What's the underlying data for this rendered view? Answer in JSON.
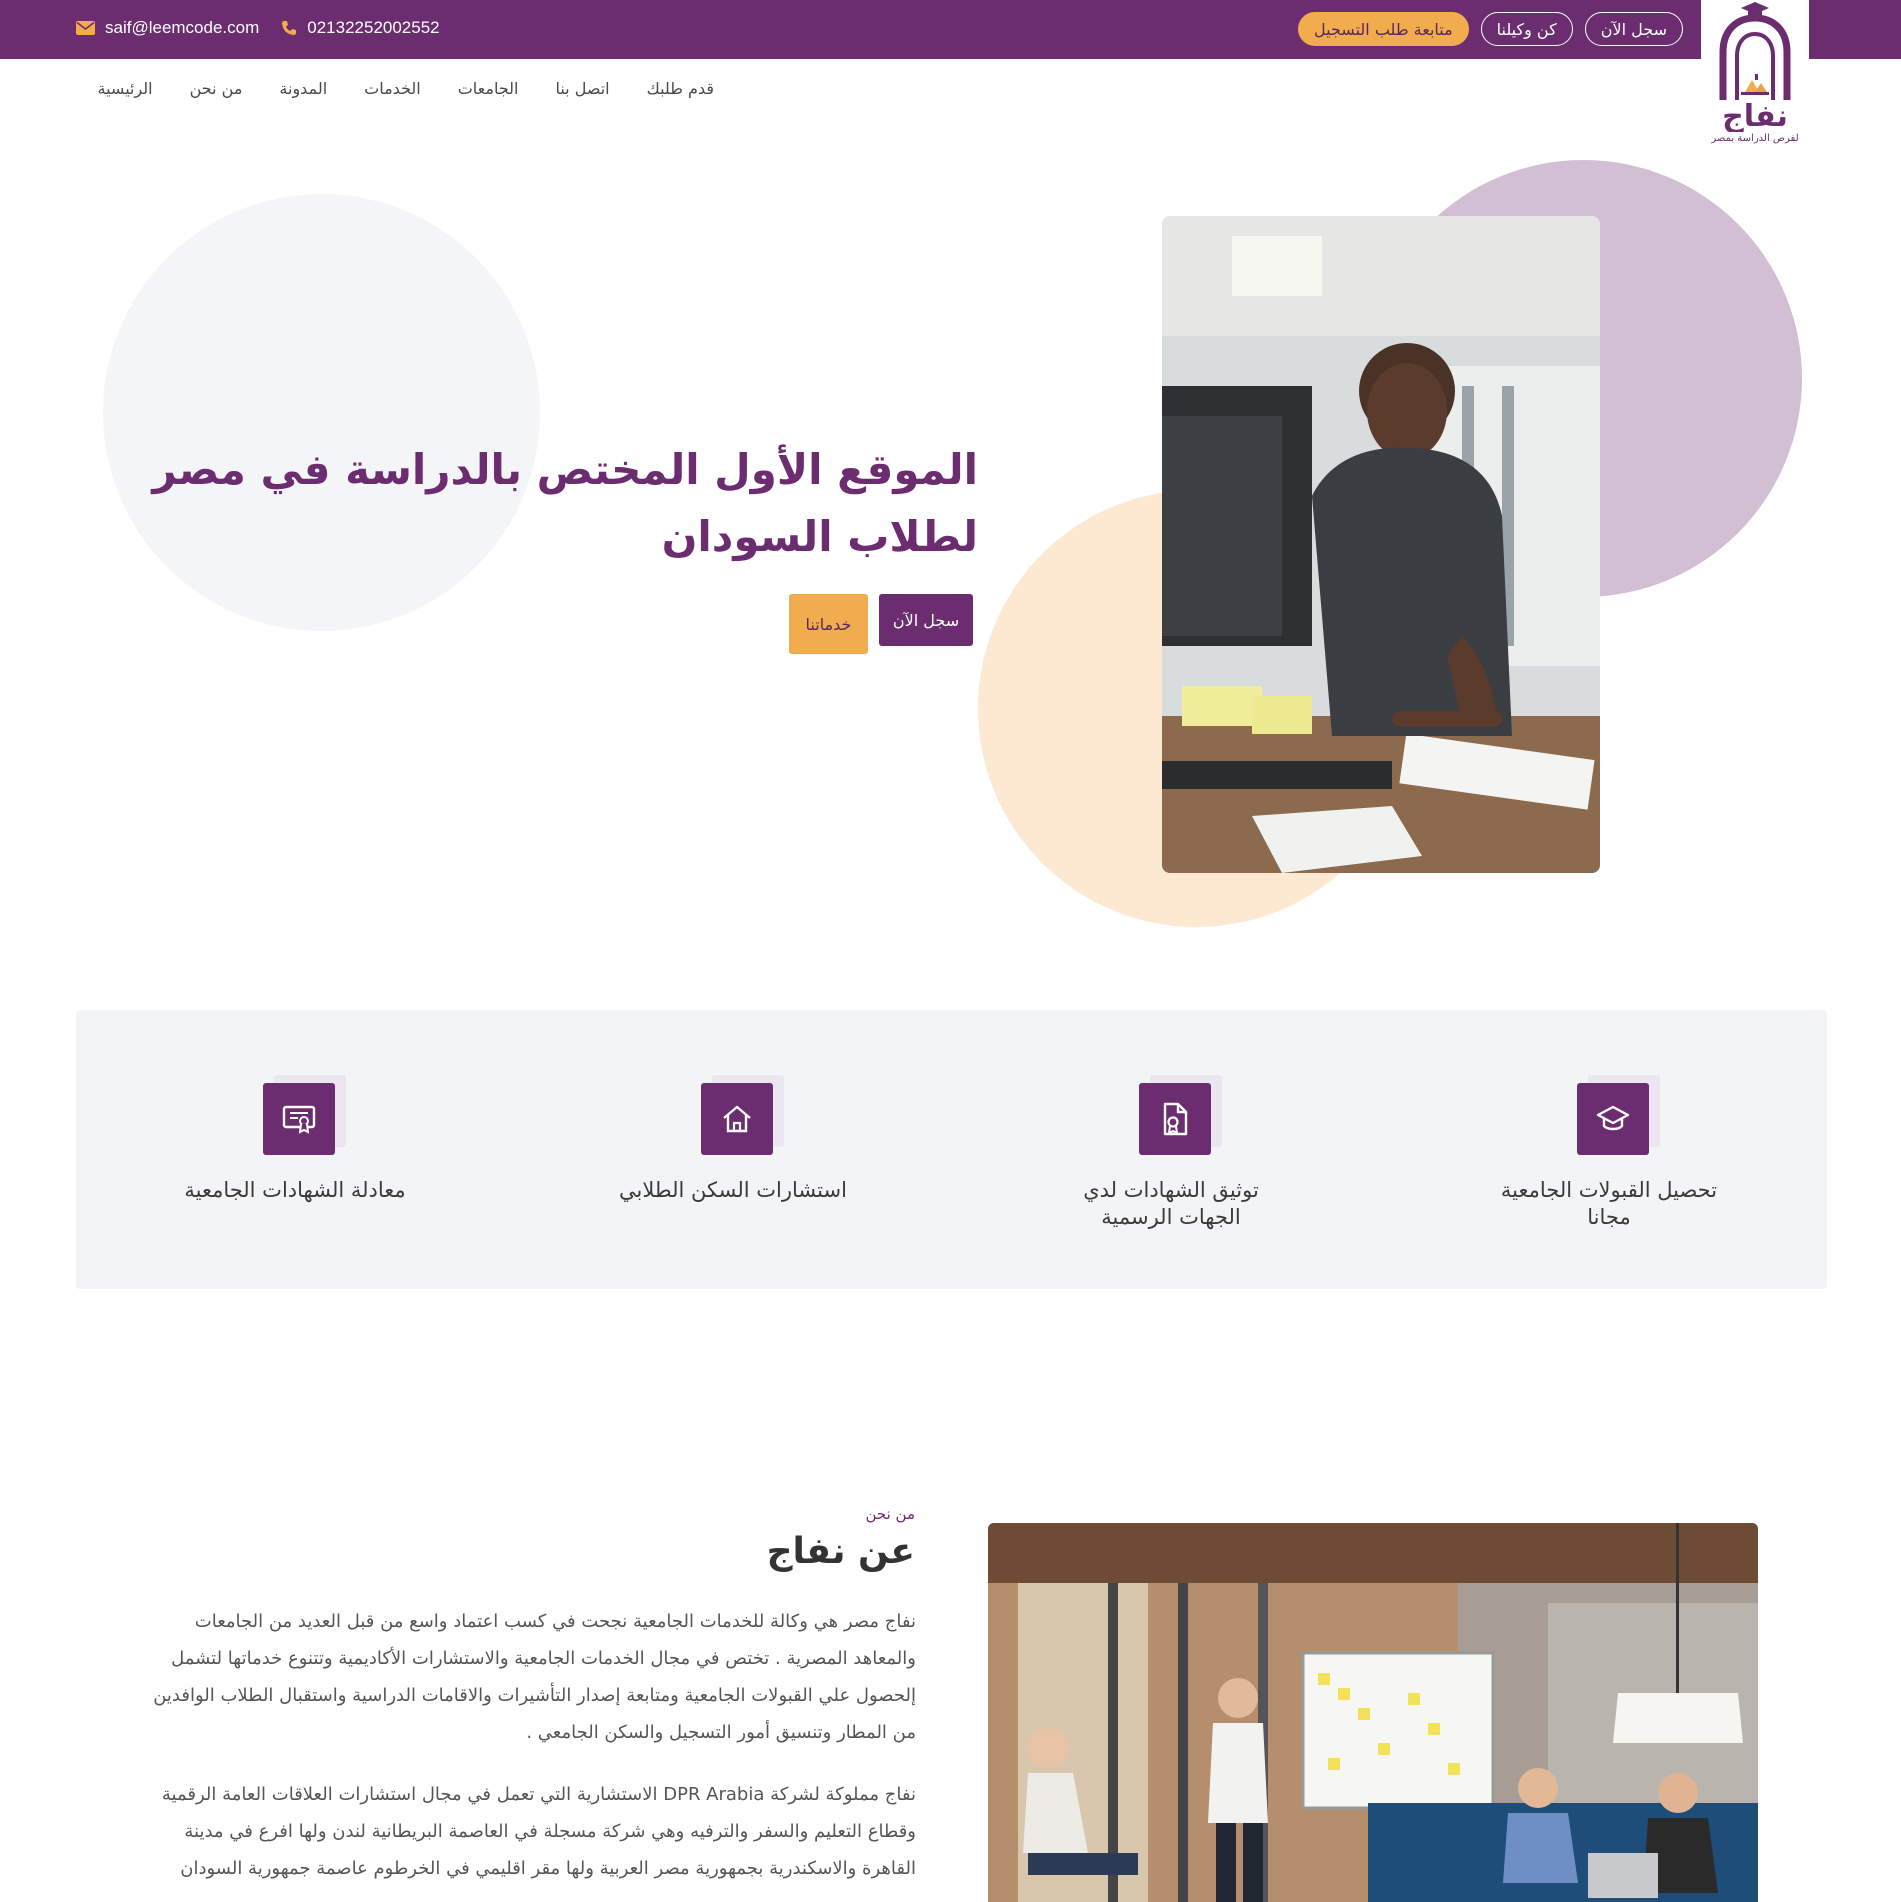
{
  "topbar": {
    "email": "saif@leemcode.com",
    "phone": "02132252002552",
    "actions": {
      "register": "سجل الآن",
      "agent": "كن وكيلنا",
      "track": "متابعة طلب التسجيل"
    }
  },
  "logo": {
    "name": "نفاج",
    "tagline": "لفرص الدراسة بمصر"
  },
  "nav": {
    "items": [
      "الرئيسية",
      "من نحن",
      "المدونة",
      "الخدمات",
      "الجامعات",
      "اتصل بنا",
      "قدم طلبك"
    ]
  },
  "hero": {
    "title": "الموقع الأول المختص بالدراسة في مصر لطلاب السودان",
    "register_button": "سجل الآن",
    "services_button": "خدماتنا"
  },
  "services": [
    {
      "title": "تحصيل القبولات الجامعية مجانا",
      "icon": "graduation-cap-icon"
    },
    {
      "title": "توثيق الشهادات لدي الجهات الرسمية",
      "icon": "document-badge-icon"
    },
    {
      "title": "استشارات السكن الطلابي",
      "icon": "home-icon"
    },
    {
      "title": "معادلة الشهادات الجامعية",
      "icon": "certificate-icon"
    }
  ],
  "about": {
    "kicker": "من نحن",
    "title": "عن نفاج",
    "paragraphs": [
      "نفاج مصر هي وكالة للخدمات الجامعية نجحت في كسب اعتماد واسع من قبل العديد من الجامعات والمعاهد المصرية . تختص في مجال الخدمات الجامعية والاستشارات الأكاديمية وتتنوع خدماتها لتشمل إلحصول علي القبولات الجامعية ومتابعة إصدار التأشيرات والاقامات الدراسية واستقبال الطلاب الوافدين من المطار وتنسيق أمور التسجيل والسكن الجامعي .",
      "نفاج مملوكة لشركة DPR Arabia الاستشارية التي تعمل في مجال استشارات العلاقات العامة الرقمية وقطاع التعليم والسفر والترفيه وهي شركة مسجلة في العاصمة البريطانية لندن ولها افرع في مدينة القاهرة والاسكندرية بجمهورية مصر العربية ولها مقر اقليمي في الخرطوم عاصمة جمهورية السودان"
    ]
  },
  "colors": {
    "brand_purple": "#6b2c70",
    "accent_orange": "#f1ac4e",
    "light_purple": "#d2bfd4",
    "peach": "#fde9d1",
    "light_grey": "#f3f4f6"
  }
}
